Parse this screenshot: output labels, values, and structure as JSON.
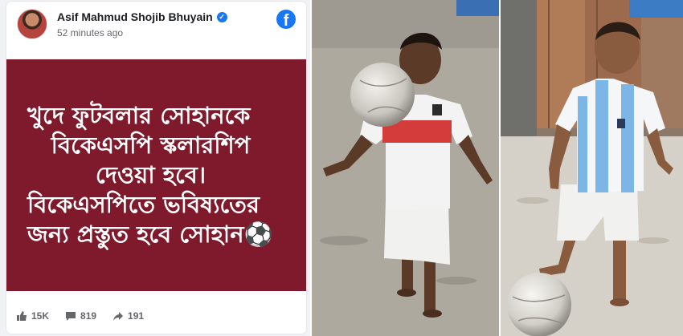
{
  "post": {
    "author_name": "Asif Mahmud Shojib Bhuyain",
    "verified_mark": "✓",
    "time": "52 minutes ago",
    "platform_icon": "facebook-logo-icon",
    "platform_letter": "f",
    "banner": {
      "background": "#7f1a2d",
      "lines": [
        "খুদে ফুটবলার সোহানকে",
        "বিকেএসপি স্কলারশিপ",
        "দেওয়া হবে।",
        "বিকেএসপিতে ভবিষ্যতের",
        "জন্য প্রস্তুত হবে সোহান⚽"
      ]
    },
    "reactions": {
      "likes": "15K",
      "comments": "819",
      "shares": "191"
    }
  },
  "photos": [
    {
      "description_icon": "boy-heading-football-photo"
    },
    {
      "description_icon": "boy-foot-on-football-photo"
    }
  ]
}
